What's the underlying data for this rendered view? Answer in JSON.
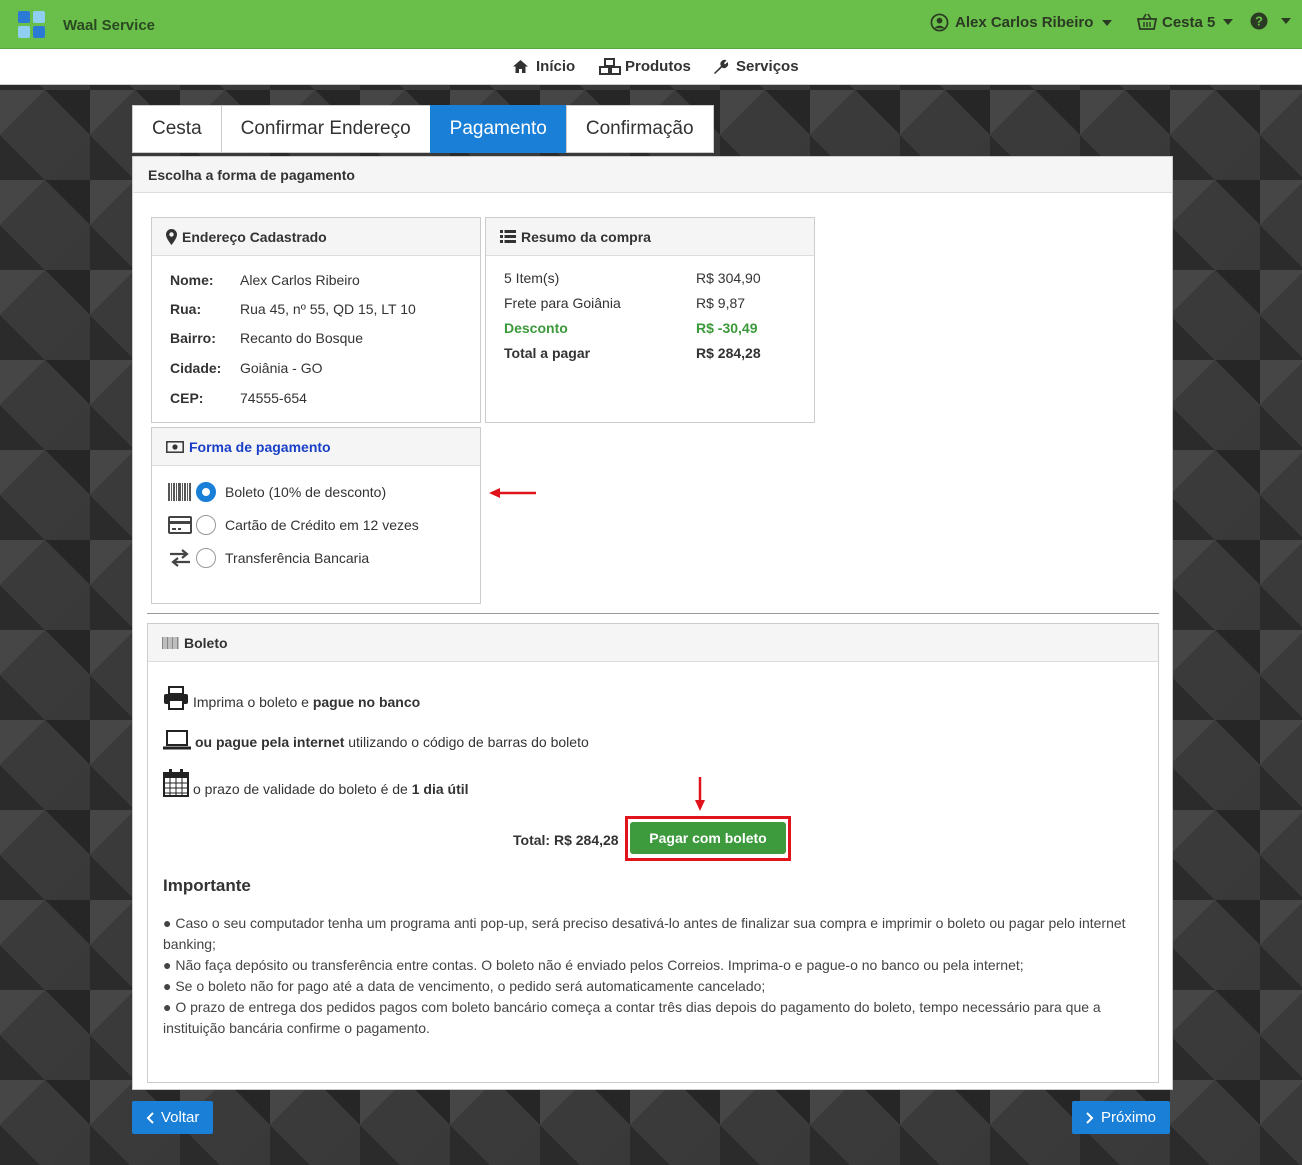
{
  "app": {
    "name": "Waal Service"
  },
  "topbar": {
    "user_name": "Alex Carlos Ribeiro",
    "cart_label": "Cesta 5"
  },
  "nav": {
    "inicio": "Início",
    "produtos": "Produtos",
    "servicos": "Serviços"
  },
  "tabs": [
    {
      "label": "Cesta"
    },
    {
      "label": "Confirmar Endereço"
    },
    {
      "label": "Pagamento"
    },
    {
      "label": "Confirmação"
    }
  ],
  "page": {
    "header": "Escolha a forma de pagamento"
  },
  "address": {
    "title": "Endereço Cadastrado",
    "rows": [
      {
        "k": "Nome:",
        "v": "Alex Carlos Ribeiro"
      },
      {
        "k": "Rua:",
        "v": "Rua 45, nº 55, QD 15, LT 10"
      },
      {
        "k": "Bairro:",
        "v": "Recanto do Bosque"
      },
      {
        "k": "Cidade:",
        "v": "Goiânia - GO"
      },
      {
        "k": "CEP:",
        "v": "74555-654"
      }
    ]
  },
  "summary": {
    "title": "Resumo da compra",
    "rows": [
      {
        "k": "5 Item(s)",
        "v": "R$ 304,90"
      },
      {
        "k": "Frete para Goiânia",
        "v": "R$ 9,87"
      },
      {
        "k": "Desconto",
        "v": "R$ -30,49"
      },
      {
        "k": "Total a pagar",
        "v": "R$ 284,28"
      }
    ]
  },
  "payment": {
    "title": "Forma de pagamento",
    "options": [
      {
        "label": "Boleto (10% de desconto)"
      },
      {
        "label": "Cartão de Crédito em 12 vezes"
      },
      {
        "label": "Transferência Bancaria"
      }
    ]
  },
  "boleto": {
    "title": "Boleto",
    "line1_a": "Imprima o boleto e ",
    "line1_b": "pague no banco",
    "line2_a": "ou pague pela internet",
    "line2_b": " utilizando o código de barras do boleto",
    "line3_a": "o prazo de validade do boleto é de ",
    "line3_b": "1 dia útil",
    "total_label": "Total: R$ 284,28",
    "pay_button": "Pagar com boleto",
    "important_title": "Importante",
    "important": [
      "● Caso o seu computador tenha um programa anti pop-up, será preciso desativá-lo antes de finalizar sua compra e imprimir o boleto ou pagar pelo internet banking;",
      "● Não faça depósito ou transferência entre contas. O boleto não é enviado pelos Correios. Imprima-o e pague-o no banco ou pela internet;",
      "● Se o boleto não for pago até a data de vencimento, o pedido será automaticamente cancelado;",
      "● O prazo de entrega dos pedidos pagos com boleto bancário começa a contar três dias depois do pagamento do boleto, tempo necessário para que a instituição bancária confirme o pagamento."
    ]
  },
  "footer": {
    "back": "Voltar",
    "next": "Próximo"
  },
  "colors": {
    "topbar": "#6abf4b",
    "primary": "#1a7fd6",
    "success": "#3d9a3d",
    "annotation": "#e0121b"
  }
}
